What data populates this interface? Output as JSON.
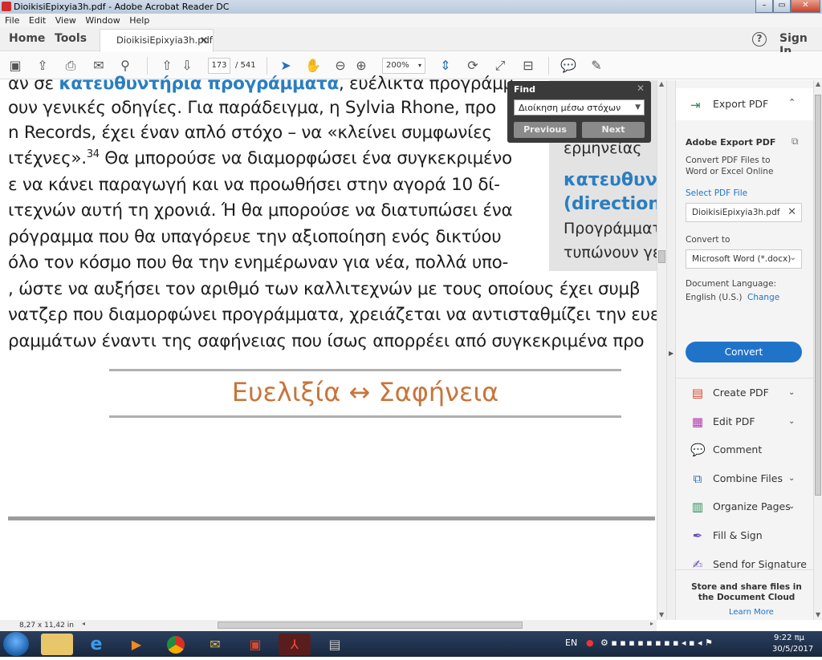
{
  "window": {
    "title": "DioikisiEpixyia3h.pdf - Adobe Acrobat Reader DC"
  },
  "menu": [
    "File",
    "Edit",
    "View",
    "Window",
    "Help"
  ],
  "nav": {
    "home": "Home",
    "tools": "Tools",
    "doc_tab": "DioikisiEpixyia3h.pdf",
    "sign_in": "Sign In",
    "help": "?"
  },
  "toolbar": {
    "page_current": "173",
    "page_total": "/ 541",
    "zoom": "200%"
  },
  "document": {
    "lines": [
      {
        "pre": "αν σε ",
        "bold": "κατευθυντήρια προγράμματα",
        "post": ", ευέλικτα προγράμμ"
      },
      {
        "pre": "ουν γενικές οδηγίες. Για παράδειγμα, η Sylvia Rhone, προ",
        "bold": "",
        "post": ""
      },
      {
        "pre": "n Records, έχει έναν απλό στόχο – να «κλείνει συμφωνίες",
        "bold": "",
        "post": ""
      },
      {
        "pre": "ιτέχνες».",
        "sup": "34",
        "post": " Θα μπορούσε να διαμορφώσει ένα συγκεκριμένο"
      },
      {
        "pre": "ε να κάνει παραγωγή και να προωθήσει στην αγορά 10 δί-",
        "bold": "",
        "post": ""
      },
      {
        "pre": "ιτεχνών αυτή τη χρονιά. Ή θα μπορούσε να διατυπώσει ένα",
        "bold": "",
        "post": ""
      },
      {
        "pre": "ρόγραμμα που θα υπαγόρευε την αξιοποίηση ενός δικτύου",
        "bold": "",
        "post": ""
      },
      {
        "pre": "όλο τον κόσμο που θα την ενημέρωναν για νέα, πολλά υπο-",
        "bold": "",
        "post": ""
      },
      {
        "pre": ", ώστε να αυξήσει τον αριθμό των καλλιτεχνών με τους οποίους έχει συμβ",
        "bold": "",
        "post": ""
      },
      {
        "pre": "νατζερ που διαμορφώνει προγράμματα, χρειάζεται να αντισταθμίζει την ευε",
        "bold": "",
        "post": ""
      },
      {
        "pre": "ραμμάτων έναντι της σαφήνειας που ίσως απορρέει από συγκεκριμένα προ",
        "bold": "",
        "post": ""
      }
    ],
    "sidebar": {
      "l1": "ερμηνείας",
      "l2": "κατευθυν",
      "l3": "(direction",
      "l4": "Προγράμματα",
      "l5": "τυπώνουν γεν"
    },
    "heading": "Ευελιξία ↔ Σαφήνεια"
  },
  "find": {
    "title": "Find",
    "query": "Διοίκηση μέσω στόχων",
    "prev": "Previous",
    "next": "Next"
  },
  "right_panel": {
    "export_pdf": "Export PDF",
    "adobe_export": "Adobe Export PDF",
    "desc": "Convert PDF Files to Word or Excel Online",
    "select_file": "Select PDF File",
    "file_name": "DioikisiEpixyia3h.pdf",
    "convert_to": "Convert to",
    "format": "Microsoft Word (*.docx)",
    "doc_lang_label": "Document Language:",
    "doc_lang": "English (U.S.)",
    "change": "Change",
    "convert_btn": "Convert",
    "tools": [
      {
        "label": "Create PDF",
        "icon": "create-pdf-icon",
        "chevron": true
      },
      {
        "label": "Edit PDF",
        "icon": "edit-pdf-icon",
        "chevron": true
      },
      {
        "label": "Comment",
        "icon": "comment-icon",
        "chevron": false
      },
      {
        "label": "Combine Files",
        "icon": "combine-icon",
        "chevron": true
      },
      {
        "label": "Organize Pages",
        "icon": "organize-icon",
        "chevron": true
      },
      {
        "label": "Fill & Sign",
        "icon": "fill-sign-icon",
        "chevron": false
      },
      {
        "label": "Send for Signature",
        "icon": "send-signature-icon",
        "chevron": false
      }
    ],
    "cloud_text": "Store and share files in the Document Cloud",
    "learn_more": "Learn More"
  },
  "status": {
    "page_size": "8,27 x 11,42 in"
  },
  "taskbar": {
    "lang": "EN",
    "time": "9:22 πμ",
    "date": "30/5/2017"
  },
  "colors": {
    "accent": "#1f73c9",
    "heading": "#c8753a",
    "doc_link": "#2a7ec1"
  }
}
